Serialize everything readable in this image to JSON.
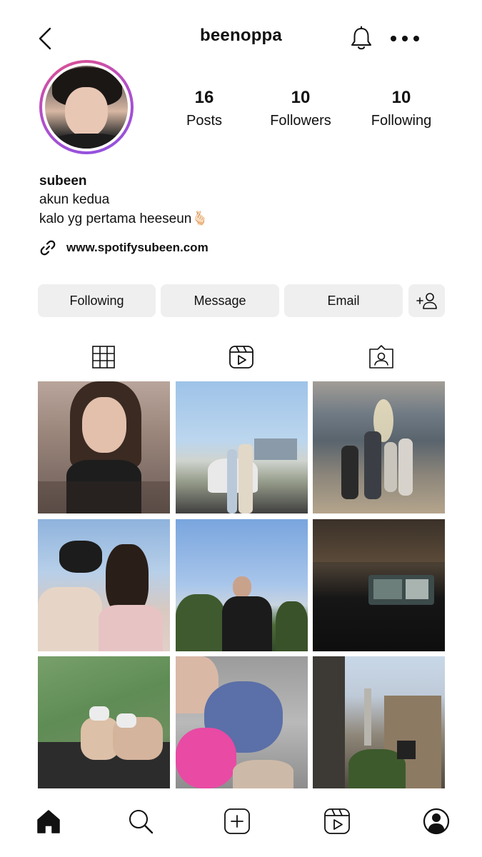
{
  "header": {
    "username": "beenoppa"
  },
  "profile": {
    "stats": {
      "posts": {
        "count": "16",
        "label": "Posts"
      },
      "followers": {
        "count": "10",
        "label": "Followers"
      },
      "following": {
        "count": "10",
        "label": "Following"
      }
    },
    "display_name": "subeen",
    "bio_lines": [
      "akun kedua",
      "kalo yg pertama heeseun🫰🏻"
    ],
    "link": "www.spotifysubeen.com"
  },
  "actions": {
    "following_label": "Following",
    "message_label": "Message",
    "email_label": "Email"
  },
  "tabs": [
    {
      "name": "grid",
      "icon": "grid-icon",
      "active": true
    },
    {
      "name": "reels",
      "icon": "reels-icon",
      "active": false
    },
    {
      "name": "tagged",
      "icon": "tagged-icon",
      "active": false
    }
  ],
  "posts": [
    {
      "type": "photo"
    },
    {
      "type": "photo"
    },
    {
      "type": "photo"
    },
    {
      "type": "photo"
    },
    {
      "type": "photo"
    },
    {
      "type": "photo"
    },
    {
      "type": "photo"
    },
    {
      "type": "photo"
    },
    {
      "type": "photo"
    }
  ],
  "bottom_nav": [
    {
      "name": "home",
      "icon": "home-icon",
      "active": true
    },
    {
      "name": "search",
      "icon": "search-icon"
    },
    {
      "name": "create",
      "icon": "create-icon"
    },
    {
      "name": "reels",
      "icon": "reels-icon"
    },
    {
      "name": "profile",
      "icon": "profile-icon"
    }
  ],
  "colors": {
    "story_ring": [
      "#e0508b",
      "#b34fc9",
      "#8d52e3"
    ],
    "button_bg": "#efefef",
    "text": "#111111"
  }
}
